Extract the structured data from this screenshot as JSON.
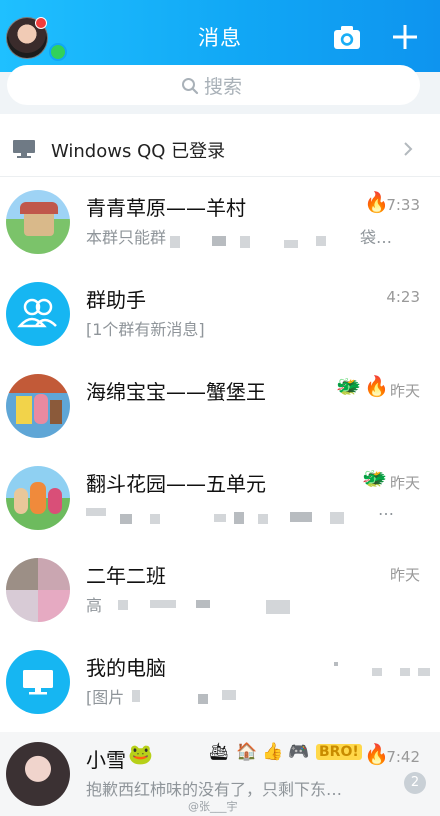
{
  "header": {
    "title": "消息"
  },
  "search": {
    "placeholder": "搜索"
  },
  "device_row": {
    "label": "Windows QQ 已登录"
  },
  "chats": [
    {
      "name": "青青草原——羊村",
      "time": "7:33",
      "preview": "本群只能群",
      "preview_tail": "袋…",
      "emoji": [
        "fire"
      ]
    },
    {
      "name": "群助手",
      "time": "4:23",
      "preview": "[1个群有新消息]"
    },
    {
      "name": "海绵宝宝——蟹堡王",
      "time": "昨天",
      "preview": "",
      "emoji": [
        "dragon",
        "fire"
      ]
    },
    {
      "name": "翻斗花园——五单元",
      "time": "昨天",
      "preview": "",
      "preview_tail": "…",
      "emoji": [
        "dragon"
      ]
    },
    {
      "name": "二年二班",
      "time": "昨天",
      "preview": "高"
    },
    {
      "name": "我的电脑",
      "time": "",
      "preview": "[图片"
    },
    {
      "name": "小雪",
      "time": "7:42",
      "preview": "抱歉西红柿味的没有了，只剩下东…",
      "unread": "2",
      "emoji": [
        "frog",
        "ship",
        "house",
        "like",
        "gamepad",
        "bro",
        "fire"
      ]
    }
  ],
  "emoji_glyphs": {
    "fire": "🔥",
    "dragon": "🐲",
    "frog": "🐸",
    "ship": "🛳",
    "house": "🏠",
    "like": "👍",
    "gamepad": "🎮",
    "bro": "BRO!"
  },
  "watermark": "@张___宇",
  "colors": {
    "header_start": "#1fc0ff",
    "header_end": "#0e94ef",
    "accent": "#16b6f2",
    "search_bg": "#f0f4f7",
    "muted_text": "#8f959a"
  }
}
